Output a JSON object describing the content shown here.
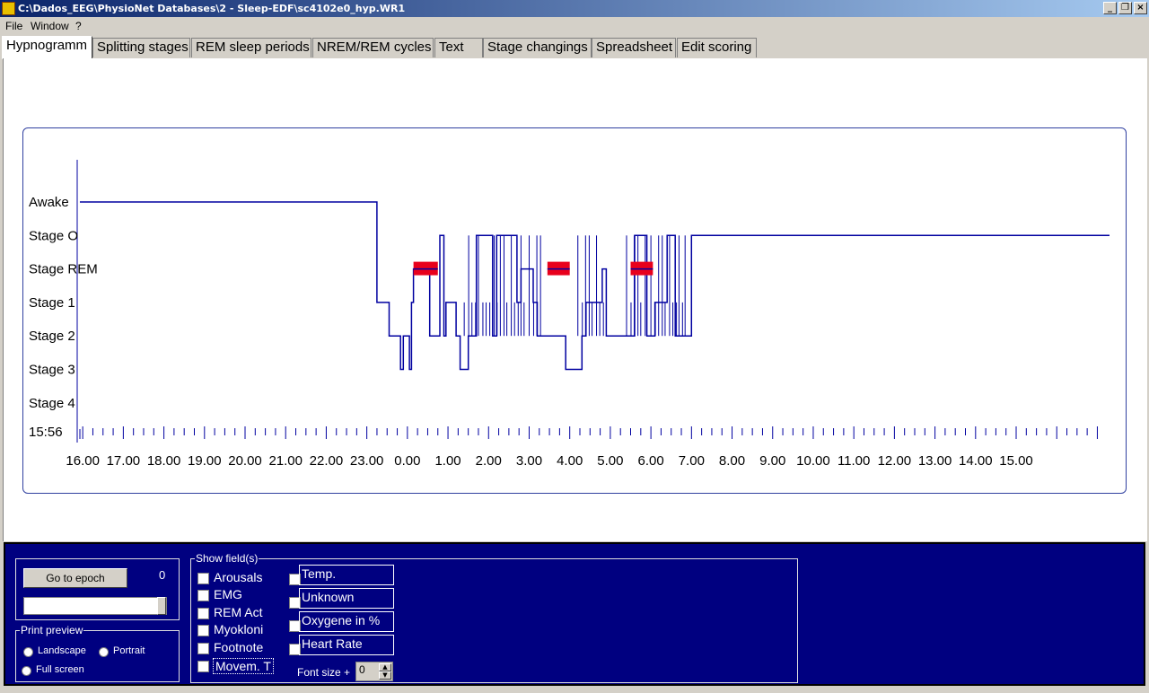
{
  "window": {
    "title": "C:\\Dados_EEG\\PhysioNet Databases\\2 - Sleep-EDF\\sc4102e0_hyp.WR1",
    "buttons": [
      "_",
      "❐",
      "×"
    ]
  },
  "menu": [
    "File",
    "Window",
    "?"
  ],
  "tabs": [
    {
      "label": "Hypnogramm",
      "active": true
    },
    {
      "label": "Splitting stages"
    },
    {
      "label": "REM sleep periods"
    },
    {
      "label": "NREM/REM cycles"
    },
    {
      "label": "Text"
    },
    {
      "label": "Stage changings"
    },
    {
      "label": "Spreadsheet"
    },
    {
      "label": "Edit scoring"
    }
  ],
  "chart_data": {
    "type": "line",
    "y_categories": [
      "Awake",
      "Stage O",
      "Stage REM",
      "Stage 1",
      "Stage 2",
      "Stage 3",
      "Stage 4"
    ],
    "start_label": "15:56",
    "x_tick_labels": [
      "16.00",
      "17.00",
      "18.00",
      "19.00",
      "20.00",
      "21.00",
      "22.00",
      "23.00",
      "0.00",
      "1.00",
      "2.00",
      "3.00",
      "4.00",
      "5.00",
      "6.00",
      "7.00",
      "8.00",
      "9.00",
      "10.00",
      "11.00",
      "12.00",
      "13.00",
      "14.00",
      "15.00"
    ],
    "line_color": "#0000a0",
    "rem_marker_color": "#e8001c",
    "series": [
      {
        "x": [
          15.93,
          23.25,
          23.25,
          23.55,
          23.55,
          23.83,
          23.83,
          23.9,
          23.9,
          24.05,
          24.05,
          24.1,
          24.1,
          24.15,
          24.15,
          24.55,
          24.55,
          24.8,
          24.8,
          24.9,
          24.9,
          24.95,
          24.95,
          25.2,
          25.2,
          25.3,
          25.3,
          25.5,
          25.5,
          25.7,
          25.7,
          26.1,
          26.1,
          26.2,
          26.2,
          26.7,
          26.7,
          26.8,
          26.8,
          27.1,
          27.1,
          27.2,
          27.2,
          27.9,
          27.9,
          28.3,
          28.3,
          28.4,
          28.4,
          28.8,
          28.8,
          28.9,
          28.9,
          29.6,
          29.6,
          29.9,
          29.9,
          30.1,
          30.1,
          30.4,
          30.4,
          30.6,
          30.6,
          31.0,
          31.0,
          31.2,
          31.2,
          41.3
        ],
        "y": [
          "Awake",
          "Awake",
          "Stage 1",
          "Stage 1",
          "Stage 2",
          "Stage 2",
          "Stage 3",
          "Stage 3",
          "Stage 2",
          "Stage 2",
          "Stage 3",
          "Stage 3",
          "Stage 1",
          "Stage 1",
          "Stage REM",
          "Stage REM",
          "Stage 2",
          "Stage 2",
          "Stage O",
          "Stage O",
          "Stage 2",
          "Stage 2",
          "Stage 1",
          "Stage 1",
          "Stage 2",
          "Stage 2",
          "Stage 3",
          "Stage 3",
          "Stage 2",
          "Stage 2",
          "Stage O",
          "Stage O",
          "Stage 2",
          "Stage 2",
          "Stage O",
          "Stage O",
          "Stage 1",
          "Stage 1",
          "Stage REM",
          "Stage REM",
          "Stage 1",
          "Stage 1",
          "Stage 2",
          "Stage 2",
          "Stage 3",
          "Stage 3",
          "Stage 2",
          "Stage 2",
          "Stage 1",
          "Stage 1",
          "Stage REM",
          "Stage REM",
          "Stage 2",
          "Stage 2",
          "Stage O",
          "Stage O",
          "Stage 2",
          "Stage 2",
          "Stage 1",
          "Stage 1",
          "Stage O",
          "Stage O",
          "Stage 2",
          "Stage 2",
          "Stage O",
          "Stage O",
          "Stage O",
          "Stage O"
        ]
      }
    ],
    "rem_periods": [
      [
        24.15,
        24.75
      ],
      [
        27.45,
        28.0
      ],
      [
        29.5,
        30.05
      ]
    ]
  },
  "controls": {
    "goto_button": "Go to epoch",
    "epoch_value": "0",
    "epoch_slider_fraction": 1.0,
    "print_preview": {
      "title": "Print preview",
      "options": [
        "Landscape",
        "Portrait",
        "Full screen"
      ]
    },
    "show_fields": {
      "title": "Show field(s)",
      "left": [
        "Arousals",
        "EMG",
        "REM Act",
        "Myokloni",
        "Footnote",
        "Movem. T"
      ],
      "right": [
        "Temp.",
        "Unknown",
        "Oxygene in %",
        "Heart Rate"
      ]
    },
    "font_size": {
      "label": "Font size +",
      "value": "0"
    }
  }
}
